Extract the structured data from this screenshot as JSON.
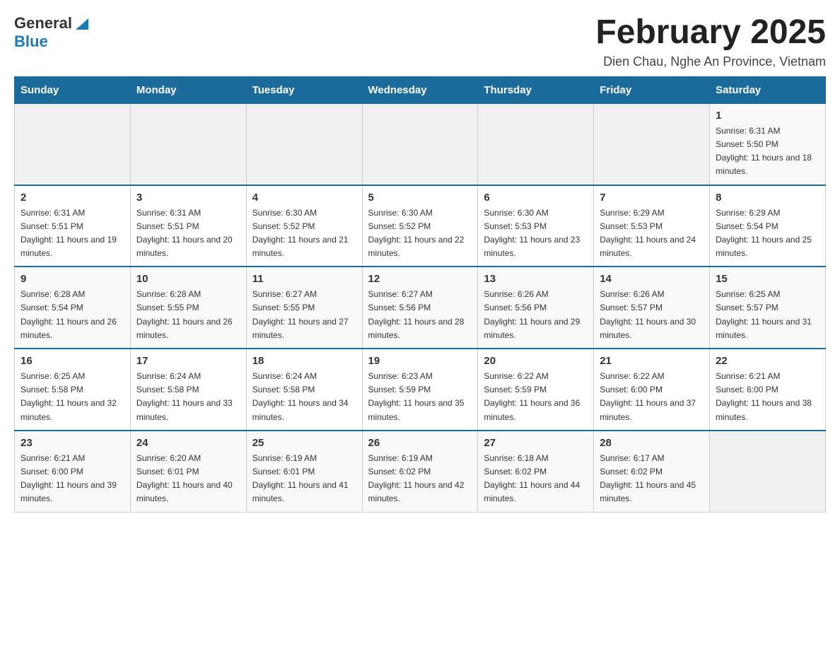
{
  "logo": {
    "general": "General",
    "blue": "Blue"
  },
  "title": "February 2025",
  "subtitle": "Dien Chau, Nghe An Province, Vietnam",
  "weekdays": [
    "Sunday",
    "Monday",
    "Tuesday",
    "Wednesday",
    "Thursday",
    "Friday",
    "Saturday"
  ],
  "weeks": [
    [
      {
        "day": "",
        "info": ""
      },
      {
        "day": "",
        "info": ""
      },
      {
        "day": "",
        "info": ""
      },
      {
        "day": "",
        "info": ""
      },
      {
        "day": "",
        "info": ""
      },
      {
        "day": "",
        "info": ""
      },
      {
        "day": "1",
        "info": "Sunrise: 6:31 AM\nSunset: 5:50 PM\nDaylight: 11 hours and 18 minutes."
      }
    ],
    [
      {
        "day": "2",
        "info": "Sunrise: 6:31 AM\nSunset: 5:51 PM\nDaylight: 11 hours and 19 minutes."
      },
      {
        "day": "3",
        "info": "Sunrise: 6:31 AM\nSunset: 5:51 PM\nDaylight: 11 hours and 20 minutes."
      },
      {
        "day": "4",
        "info": "Sunrise: 6:30 AM\nSunset: 5:52 PM\nDaylight: 11 hours and 21 minutes."
      },
      {
        "day": "5",
        "info": "Sunrise: 6:30 AM\nSunset: 5:52 PM\nDaylight: 11 hours and 22 minutes."
      },
      {
        "day": "6",
        "info": "Sunrise: 6:30 AM\nSunset: 5:53 PM\nDaylight: 11 hours and 23 minutes."
      },
      {
        "day": "7",
        "info": "Sunrise: 6:29 AM\nSunset: 5:53 PM\nDaylight: 11 hours and 24 minutes."
      },
      {
        "day": "8",
        "info": "Sunrise: 6:29 AM\nSunset: 5:54 PM\nDaylight: 11 hours and 25 minutes."
      }
    ],
    [
      {
        "day": "9",
        "info": "Sunrise: 6:28 AM\nSunset: 5:54 PM\nDaylight: 11 hours and 26 minutes."
      },
      {
        "day": "10",
        "info": "Sunrise: 6:28 AM\nSunset: 5:55 PM\nDaylight: 11 hours and 26 minutes."
      },
      {
        "day": "11",
        "info": "Sunrise: 6:27 AM\nSunset: 5:55 PM\nDaylight: 11 hours and 27 minutes."
      },
      {
        "day": "12",
        "info": "Sunrise: 6:27 AM\nSunset: 5:56 PM\nDaylight: 11 hours and 28 minutes."
      },
      {
        "day": "13",
        "info": "Sunrise: 6:26 AM\nSunset: 5:56 PM\nDaylight: 11 hours and 29 minutes."
      },
      {
        "day": "14",
        "info": "Sunrise: 6:26 AM\nSunset: 5:57 PM\nDaylight: 11 hours and 30 minutes."
      },
      {
        "day": "15",
        "info": "Sunrise: 6:25 AM\nSunset: 5:57 PM\nDaylight: 11 hours and 31 minutes."
      }
    ],
    [
      {
        "day": "16",
        "info": "Sunrise: 6:25 AM\nSunset: 5:58 PM\nDaylight: 11 hours and 32 minutes."
      },
      {
        "day": "17",
        "info": "Sunrise: 6:24 AM\nSunset: 5:58 PM\nDaylight: 11 hours and 33 minutes."
      },
      {
        "day": "18",
        "info": "Sunrise: 6:24 AM\nSunset: 5:58 PM\nDaylight: 11 hours and 34 minutes."
      },
      {
        "day": "19",
        "info": "Sunrise: 6:23 AM\nSunset: 5:59 PM\nDaylight: 11 hours and 35 minutes."
      },
      {
        "day": "20",
        "info": "Sunrise: 6:22 AM\nSunset: 5:59 PM\nDaylight: 11 hours and 36 minutes."
      },
      {
        "day": "21",
        "info": "Sunrise: 6:22 AM\nSunset: 6:00 PM\nDaylight: 11 hours and 37 minutes."
      },
      {
        "day": "22",
        "info": "Sunrise: 6:21 AM\nSunset: 6:00 PM\nDaylight: 11 hours and 38 minutes."
      }
    ],
    [
      {
        "day": "23",
        "info": "Sunrise: 6:21 AM\nSunset: 6:00 PM\nDaylight: 11 hours and 39 minutes."
      },
      {
        "day": "24",
        "info": "Sunrise: 6:20 AM\nSunset: 6:01 PM\nDaylight: 11 hours and 40 minutes."
      },
      {
        "day": "25",
        "info": "Sunrise: 6:19 AM\nSunset: 6:01 PM\nDaylight: 11 hours and 41 minutes."
      },
      {
        "day": "26",
        "info": "Sunrise: 6:19 AM\nSunset: 6:02 PM\nDaylight: 11 hours and 42 minutes."
      },
      {
        "day": "27",
        "info": "Sunrise: 6:18 AM\nSunset: 6:02 PM\nDaylight: 11 hours and 44 minutes."
      },
      {
        "day": "28",
        "info": "Sunrise: 6:17 AM\nSunset: 6:02 PM\nDaylight: 11 hours and 45 minutes."
      },
      {
        "day": "",
        "info": ""
      }
    ]
  ]
}
